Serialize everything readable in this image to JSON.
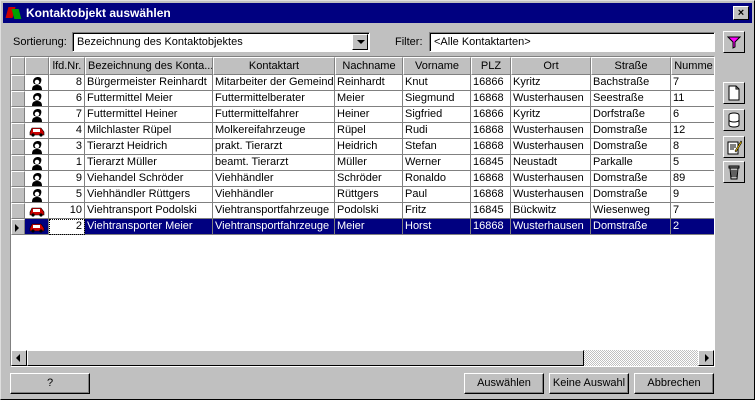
{
  "window": {
    "title": "Kontaktobjekt auswählen",
    "close_label": "×"
  },
  "toolbar": {
    "sort_label": "Sortierung:",
    "sort_value": "Bezeichnung des Kontaktobjektes",
    "filter_label": "Filter:",
    "filter_value": "<Alle Kontaktarten>"
  },
  "table": {
    "columns": [
      "lfd.Nr.",
      "Bezeichnung des Konta...",
      "Kontaktart",
      "Nachname",
      "Vorname",
      "PLZ",
      "Ort",
      "Straße",
      "Numme"
    ],
    "rows": [
      {
        "type": "person",
        "nr": "8",
        "bez": "Bürgermeister Reinhardt",
        "art": "Mitarbeiter der Gemeinde",
        "nach": "Reinhardt",
        "vor": "Knut",
        "plz": "16866",
        "ort": "Kyritz",
        "str": "Bachstraße",
        "num": "7"
      },
      {
        "type": "person",
        "nr": "6",
        "bez": "Futtermittel Meier",
        "art": "Futtermittelberater",
        "nach": "Meier",
        "vor": "Siegmund",
        "plz": "16868",
        "ort": "Wusterhausen",
        "str": "Seestraße",
        "num": "11"
      },
      {
        "type": "person",
        "nr": "7",
        "bez": "Futtermittel Heiner",
        "art": "Futtermittelfahrer",
        "nach": "Heiner",
        "vor": "Sigfried",
        "plz": "16866",
        "ort": "Kyritz",
        "str": "Dorfstraße",
        "num": "6"
      },
      {
        "type": "vehicle",
        "nr": "4",
        "bez": "Milchlaster Rüpel",
        "art": "Molkereifahrzeuge",
        "nach": "Rüpel",
        "vor": "Rudi",
        "plz": "16868",
        "ort": "Wusterhausen",
        "str": "Domstraße",
        "num": "12"
      },
      {
        "type": "person",
        "nr": "3",
        "bez": "Tierarzt Heidrich",
        "art": "prakt. Tierarzt",
        "nach": "Heidrich",
        "vor": "Stefan",
        "plz": "16868",
        "ort": "Wusterhausen",
        "str": "Domstraße",
        "num": "8"
      },
      {
        "type": "person",
        "nr": "1",
        "bez": "Tierarzt Müller",
        "art": "beamt. Tierarzt",
        "nach": "Müller",
        "vor": "Werner",
        "plz": "16845",
        "ort": "Neustadt",
        "str": "Parkalle",
        "num": "5"
      },
      {
        "type": "person",
        "nr": "9",
        "bez": "Viehandel Schröder",
        "art": "Viehhändler",
        "nach": "Schröder",
        "vor": "Ronaldo",
        "plz": "16868",
        "ort": "Wusterhausen",
        "str": "Domstraße",
        "num": "89"
      },
      {
        "type": "person",
        "nr": "5",
        "bez": "Viehhändler Rüttgers",
        "art": "Viehhändler",
        "nach": "Rüttgers",
        "vor": "Paul",
        "plz": "16868",
        "ort": "Wusterhausen",
        "str": "Domstraße",
        "num": "9"
      },
      {
        "type": "vehicle",
        "nr": "10",
        "bez": "Viehtransport Podolski",
        "art": "Viehtransportfahrzeuge",
        "nach": "Podolski",
        "vor": "Fritz",
        "plz": "16845",
        "ort": "Bückwitz",
        "str": "Wiesenweg",
        "num": "7"
      },
      {
        "type": "vehicle",
        "nr": "2",
        "bez": "Viehtransporter Meier",
        "art": "Viehtransportfahrzeuge",
        "nach": "Meier",
        "vor": "Horst",
        "plz": "16868",
        "ort": "Wusterhausen",
        "str": "Domstraße",
        "num": "2",
        "selected": true
      }
    ]
  },
  "buttons": {
    "help": "?",
    "select": "Auswählen",
    "no_select": "Keine Auswahl",
    "cancel": "Abbrechen"
  },
  "icons": {
    "filter": "funnel-icon",
    "new": "new-document-icon",
    "database": "database-icon",
    "edit": "edit-icon",
    "delete": "trash-icon",
    "person": "person-icon",
    "vehicle": "car-icon"
  },
  "colors": {
    "titlebar": "#000080",
    "selection": "#000080",
    "face": "#c0c0c0",
    "filter_icon": "#ff00ff",
    "car": "#cc0000"
  }
}
